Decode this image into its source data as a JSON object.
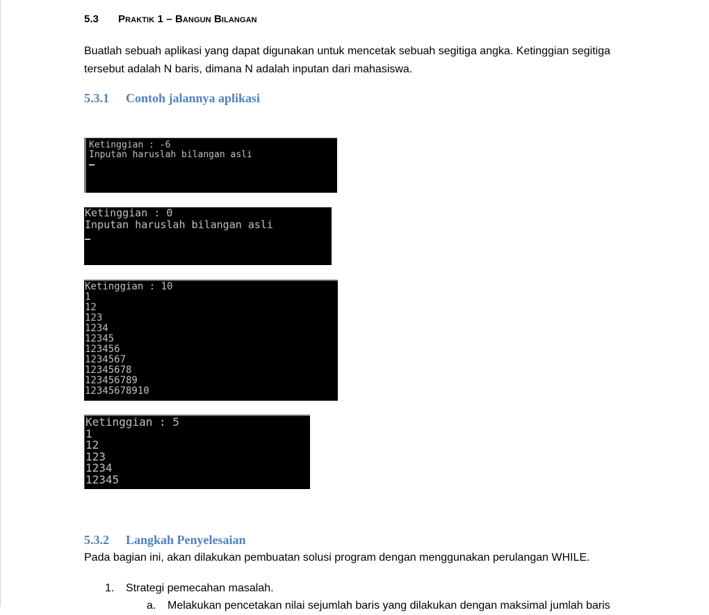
{
  "section": {
    "number": "5.3",
    "title": "Praktik 1 – Bangun Bilangan"
  },
  "intro": "Buatlah sebuah aplikasi yang dapat digunakan untuk mencetak sebuah segitiga angka. Ketinggian segitiga tersebut adalah N baris, dimana N adalah inputan dari mahasiswa.",
  "sub1": {
    "number": "5.3.1",
    "title": "Contoh jalannya aplikasi"
  },
  "consoles": [
    {
      "lines": [
        "Ketinggian : -6",
        "Inputan haruslah bilangan asli"
      ]
    },
    {
      "lines": [
        "Ketinggian : 0",
        "Inputan haruslah bilangan asli"
      ]
    },
    {
      "lines": [
        "Ketinggian : 10",
        "1",
        "12",
        "123",
        "1234",
        "12345",
        "123456",
        "1234567",
        "12345678",
        "123456789",
        "12345678910"
      ]
    },
    {
      "lines": [
        "Ketinggian : 5",
        "1",
        "12",
        "123",
        "1234",
        "12345"
      ]
    }
  ],
  "sub2": {
    "number": "5.3.2",
    "title": "Langkah Penyelesaian"
  },
  "sub2_para": "Pada bagian ini, akan dilakukan pembuatan solusi program dengan menggunakan perulangan WHILE.",
  "list": [
    {
      "number": "1.",
      "text": "Strategi pemecahan masalah."
    }
  ],
  "sublist": [
    {
      "number": "a.",
      "text": "Melakukan pencetakan nilai sejumlah baris yang dilakukan dengan maksimal jumlah baris"
    }
  ]
}
